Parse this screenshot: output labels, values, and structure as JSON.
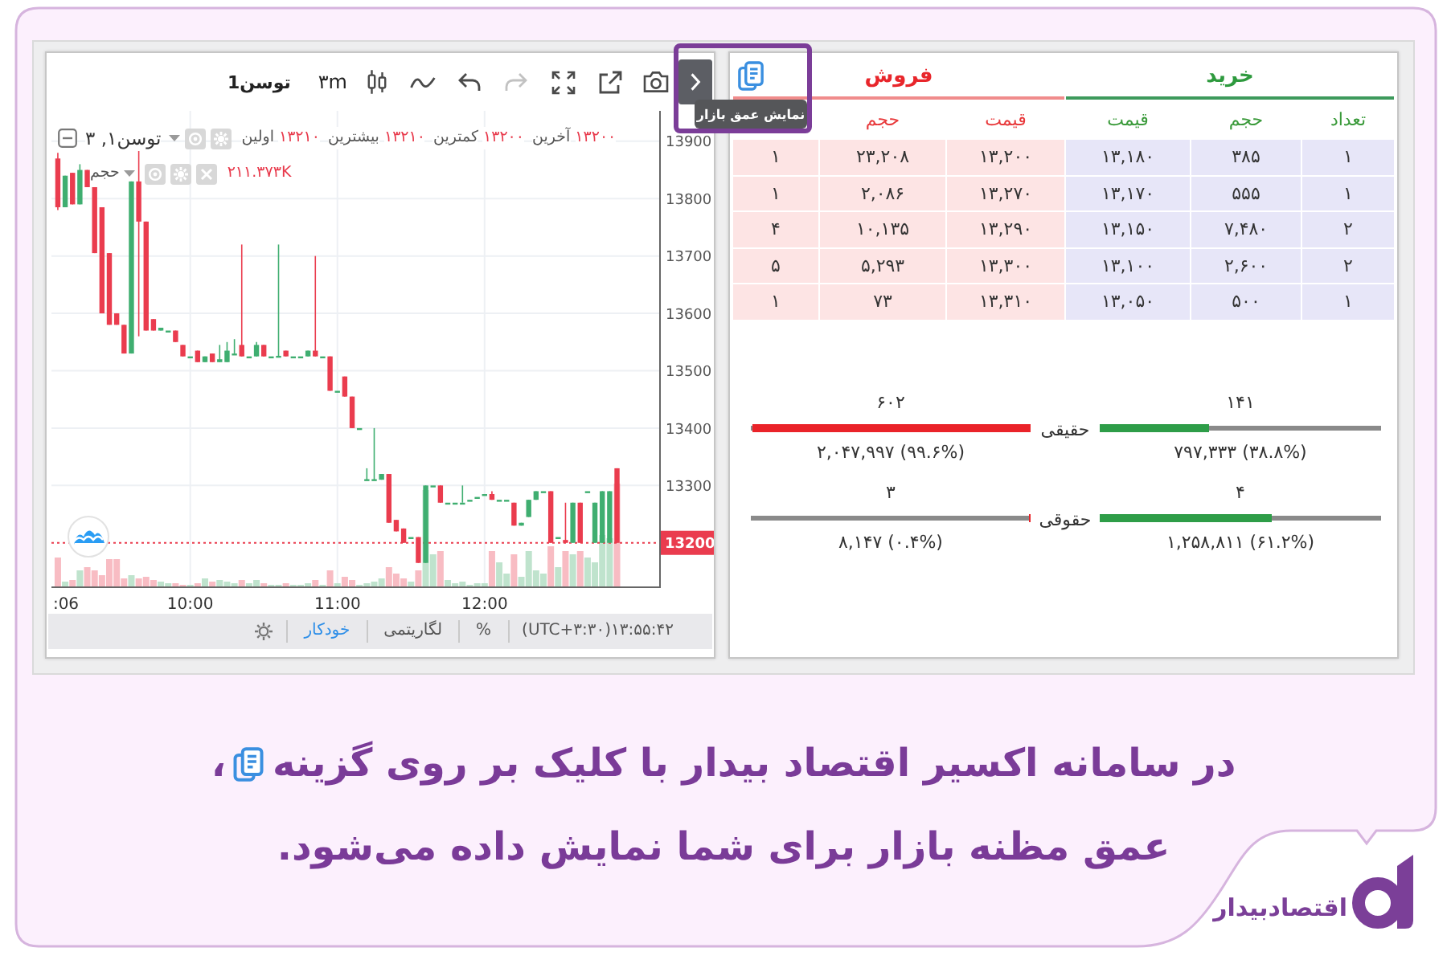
{
  "chart_panel": {
    "toolbar": {
      "symbol": "توسن1",
      "interval": "۳m",
      "tools": [
        {
          "kind": "snapshot",
          "disabled": false
        },
        {
          "kind": "popout",
          "disabled": false
        },
        {
          "kind": "fullscreen",
          "disabled": false
        },
        {
          "kind": "redo",
          "disabled": true
        },
        {
          "kind": "undo",
          "disabled": false
        },
        {
          "kind": "indicators",
          "disabled": false
        },
        {
          "kind": "candles",
          "disabled": false
        }
      ]
    },
    "legend": {
      "series": "توسن۱, ۳",
      "readings": [
        {
          "kind": "value",
          "text": "۱۳۲۰۰"
        },
        {
          "kind": "label",
          "text": "آخرین"
        },
        {
          "kind": "value",
          "text": "۱۳۲۰۰"
        },
        {
          "kind": "label",
          "text": "کمترین"
        },
        {
          "kind": "value",
          "text": "۱۳۲۱۰"
        },
        {
          "kind": "label",
          "text": "بیشترین"
        },
        {
          "kind": "value",
          "text": "۱۳۲۱۰"
        },
        {
          "kind": "label",
          "text": "اولین"
        }
      ],
      "volume_label": "حجم",
      "volume_value": "۲۱۱.۳۷۳K"
    },
    "chart_data": {
      "type": "candlestick",
      "x": [
        546,
        549,
        552,
        555,
        558,
        561,
        564,
        567,
        570,
        573,
        576,
        579,
        582,
        585,
        588,
        591,
        594,
        597,
        600,
        603,
        606,
        609,
        612,
        615,
        618,
        621,
        624,
        627,
        630,
        633,
        636,
        639,
        642,
        645,
        648,
        651,
        654,
        657,
        660,
        663,
        666,
        669,
        672,
        675,
        678,
        681,
        684,
        687,
        690,
        693,
        696,
        699,
        702,
        705,
        708,
        711,
        714,
        717,
        720,
        723,
        726,
        729,
        732,
        735,
        738,
        741,
        744,
        747,
        750,
        753,
        756,
        759,
        762,
        765,
        768,
        771,
        774
      ],
      "ohlc": [
        [
          13870,
          13880,
          13780,
          13785
        ],
        [
          13785,
          13840,
          13785,
          13840
        ],
        [
          13845,
          13845,
          13790,
          13790
        ],
        [
          13790,
          13860,
          13790,
          13850
        ],
        [
          13850,
          13850,
          13820,
          13820
        ],
        [
          13820,
          13820,
          13705,
          13705
        ],
        [
          13785,
          13785,
          13600,
          13600
        ],
        [
          13705,
          13705,
          13580,
          13580
        ],
        [
          13600,
          13600,
          13580,
          13580
        ],
        [
          13580,
          13580,
          13530,
          13530
        ],
        [
          13530,
          13830,
          13530,
          13830
        ],
        [
          13830,
          13883,
          13560,
          13760
        ],
        [
          13760,
          13760,
          13570,
          13570
        ],
        [
          13590,
          13590,
          13570,
          13570
        ],
        [
          13570,
          13575,
          13570,
          13575
        ],
        [
          13570,
          13570,
          13570,
          13570
        ],
        [
          13570,
          13570,
          13550,
          13550
        ],
        [
          13545,
          13545,
          13525,
          13525
        ],
        [
          13525,
          13525,
          13525,
          13525
        ],
        [
          13535,
          13535,
          13515,
          13515
        ],
        [
          13515,
          13525,
          13515,
          13525
        ],
        [
          13530,
          13530,
          13515,
          13515
        ],
        [
          13515,
          13545,
          13515,
          13520
        ],
        [
          13515,
          13550,
          13515,
          13535
        ],
        [
          13530,
          13555,
          13530,
          13530
        ],
        [
          13545,
          13720,
          13525,
          13525
        ],
        [
          13525,
          13525,
          13525,
          13525
        ],
        [
          13525,
          13550,
          13525,
          13545
        ],
        [
          13545,
          13545,
          13525,
          13525
        ],
        [
          13525,
          13525,
          13525,
          13525
        ],
        [
          13525,
          13720,
          13525,
          13526
        ],
        [
          13535,
          13535,
          13525,
          13525
        ],
        [
          13525,
          13525,
          13525,
          13525
        ],
        [
          13525,
          13525,
          13525,
          13525
        ],
        [
          13525,
          13535,
          13525,
          13535
        ],
        [
          13535,
          13700,
          13525,
          13525
        ],
        [
          13525,
          13525,
          13525,
          13525
        ],
        [
          13525,
          13525,
          13465,
          13465
        ],
        [
          13465,
          13465,
          13465,
          13465
        ],
        [
          13490,
          13490,
          13455,
          13455
        ],
        [
          13455,
          13455,
          13400,
          13400
        ],
        [
          13400,
          13400,
          13400,
          13400
        ],
        [
          13310,
          13330,
          13310,
          13311
        ],
        [
          13310,
          13400,
          13310,
          13311
        ],
        [
          13310,
          13320,
          13310,
          13320
        ],
        [
          13320,
          13320,
          13235,
          13235
        ],
        [
          13240,
          13240,
          13220,
          13220
        ],
        [
          13225,
          13225,
          13200,
          13200
        ],
        [
          13210,
          13210,
          13210,
          13210
        ],
        [
          13210,
          13210,
          13165,
          13165
        ],
        [
          13165,
          13300,
          13165,
          13300
        ],
        [
          13300,
          13300,
          13300,
          13300
        ],
        [
          13300,
          13300,
          13270,
          13270
        ],
        [
          13270,
          13270,
          13270,
          13270
        ],
        [
          13270,
          13270,
          13270,
          13270
        ],
        [
          13270,
          13300,
          13270,
          13270
        ],
        [
          13275,
          13275,
          13275,
          13275
        ],
        [
          13280,
          13280,
          13280,
          13280
        ],
        [
          13285,
          13285,
          13285,
          13285
        ],
        [
          13285,
          13290,
          13275,
          13275
        ],
        [
          13275,
          13275,
          13275,
          13275
        ],
        [
          13275,
          13275,
          13275,
          13275
        ],
        [
          13270,
          13270,
          13230,
          13230
        ],
        [
          13230,
          13235,
          13230,
          13235
        ],
        [
          13245,
          13275,
          13245,
          13275
        ],
        [
          13275,
          13290,
          13275,
          13290
        ],
        [
          13290,
          13290,
          13290,
          13290
        ],
        [
          13290,
          13290,
          13200,
          13200
        ],
        [
          13210,
          13210,
          13210,
          13210
        ],
        [
          13205,
          13270,
          13200,
          13200
        ],
        [
          13200,
          13270,
          13200,
          13270
        ],
        [
          13270,
          13270,
          13200,
          13200
        ],
        [
          13290,
          13290,
          13290,
          13290
        ],
        [
          13200,
          13270,
          13200,
          13270
        ],
        [
          13200,
          13290,
          13200,
          13290
        ],
        [
          13200,
          13290,
          13200,
          13290
        ],
        [
          13330,
          13330,
          13200,
          13200
        ]
      ],
      "xlim": [
        543.4,
        791.2
      ],
      "ylim": [
        13124,
        13953
      ],
      "xticks": [
        {
          "value": 600,
          "label": "10:00"
        },
        {
          "value": 660,
          "label": "11:00"
        },
        {
          "value": 720,
          "label": "12:00"
        }
      ],
      "yticks": [
        13300,
        13400,
        13500,
        13600,
        13700,
        13800,
        13900
      ],
      "grid": true,
      "ref_lines": [
        {
          "axis": "y",
          "value": 13200
        }
      ]
    },
    "cut_time_label": ":06",
    "last_price": "13200",
    "status_bar": {
      "clock": "(UTC+۳:۳۰)۱۳:۵۵:۴۲",
      "options": [
        {
          "label": "%",
          "selected": false
        },
        {
          "label": "لگاریتمی",
          "selected": false
        },
        {
          "label": "خودکار",
          "selected": true
        }
      ]
    }
  },
  "order_book": {
    "buy": {
      "title": "خرید",
      "columns": [
        "تعداد",
        "حجم",
        "قیمت"
      ],
      "rows": [
        [
          "۱",
          "۳۸۵",
          "۱۳,۱۸۰"
        ],
        [
          "۱",
          "۵۵۵",
          "۱۳,۱۷۰"
        ],
        [
          "۲",
          "۷,۴۸۰",
          "۱۳,۱۵۰"
        ],
        [
          "۲",
          "۲,۶۰۰",
          "۱۳,۱۰۰"
        ],
        [
          "۱",
          "۵۰۰",
          "۱۳,۰۵۰"
        ]
      ]
    },
    "sell": {
      "title": "فروش",
      "columns": [
        "قیمت",
        "حجم"
      ],
      "rows": [
        [
          "۱۳,۲۰۰",
          "۲۳,۲۰۸",
          "۱"
        ],
        [
          "۱۳,۲۷۰",
          "۲,۰۸۶",
          "۱"
        ],
        [
          "۱۳,۲۹۰",
          "۱۰,۱۳۵",
          "۴"
        ],
        [
          "۱۳,۳۰۰",
          "۵,۲۹۳",
          "۵"
        ],
        [
          "۱۳,۳۱۰",
          "۷۳",
          "۱"
        ]
      ]
    },
    "traders": [
      {
        "label": "حقیقی",
        "buy": {
          "count": "۱۴۱",
          "volume": "۷۹۷,۳۳۳ (۳۸.۸%)",
          "level": 0.388
        },
        "sell": {
          "count": "۶۰۲",
          "volume": "۲,۰۴۷,۹۹۷ (۹۹.۶%)",
          "level": 0.996
        }
      },
      {
        "label": "حقوقی",
        "buy": {
          "count": "۴",
          "volume": "۱,۲۵۸,۸۱۱ (۶۱.۲%)",
          "level": 0.612
        },
        "sell": {
          "count": "۳",
          "volume": "۸,۱۴۷ (۰.۴%)",
          "level": 0.004
        }
      }
    ]
  },
  "tooltip": {
    "text": "نمایش عمق بازار"
  },
  "caption": {
    "line_1": "در سامانه اکسیر اقتصاد بیدار با کلیک بر روی گزینه",
    "after_icon": "،",
    "line_2": "عمق مظنه بازار برای شما نمایش داده می‌شود."
  },
  "brand": {
    "name": "اقتصادبیدار"
  }
}
